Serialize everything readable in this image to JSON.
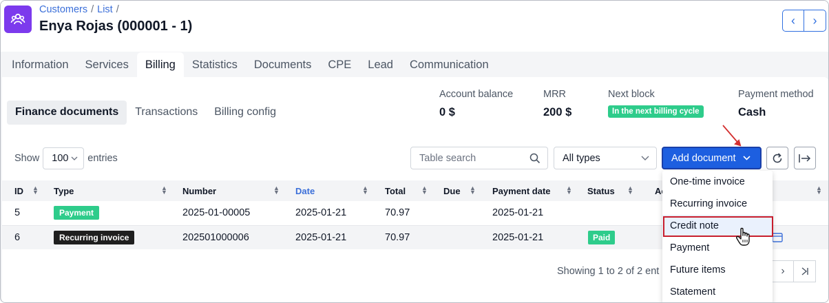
{
  "breadcrumb": {
    "customers": "Customers",
    "list": "List",
    "sep": "/"
  },
  "page_title": "Enya Rojas (000001 - 1)",
  "tabs": [
    {
      "label": "Information"
    },
    {
      "label": "Services"
    },
    {
      "label": "Billing"
    },
    {
      "label": "Statistics"
    },
    {
      "label": "Documents"
    },
    {
      "label": "CPE"
    },
    {
      "label": "Lead"
    },
    {
      "label": "Communication"
    }
  ],
  "subtabs": [
    {
      "label": "Finance documents"
    },
    {
      "label": "Transactions"
    },
    {
      "label": "Billing config"
    }
  ],
  "summary": {
    "account_balance_label": "Account balance",
    "account_balance": "0 $",
    "mrr_label": "MRR",
    "mrr": "200 $",
    "next_block_label": "Next block",
    "next_block": "In the next billing cycle",
    "payment_method_label": "Payment method",
    "payment_method": "Cash"
  },
  "controls": {
    "show": "Show",
    "entries_value": "100",
    "entries": "entries",
    "search_placeholder": "Table search",
    "types_value": "All types",
    "add_document": "Add document"
  },
  "table": {
    "headers": [
      "ID",
      "Type",
      "Number",
      "Date",
      "Total",
      "Due",
      "Payment date",
      "Status",
      "Ac"
    ],
    "rows": [
      {
        "id": "5",
        "type": "Payment",
        "number": "2025-01-00005",
        "date": "2025-01-21",
        "total": "70.97",
        "due": "",
        "payment_date": "2025-01-21",
        "status": ""
      },
      {
        "id": "6",
        "type": "Recurring invoice",
        "number": "202501000006",
        "date": "2025-01-21",
        "total": "70.97",
        "due": "",
        "payment_date": "2025-01-21",
        "status": "Paid"
      }
    ]
  },
  "footer": {
    "showing": "Showing 1 to 2 of 2 ent"
  },
  "dropdown": {
    "items": [
      "One-time invoice",
      "Recurring invoice",
      "Credit note",
      "Payment",
      "Future items",
      "Statement"
    ],
    "selected": "Credit note"
  },
  "colors": {
    "accent": "#1d5fe0",
    "brand": "#7c3aed",
    "success": "#2ecc8b",
    "highlight": "#c81e2c"
  }
}
